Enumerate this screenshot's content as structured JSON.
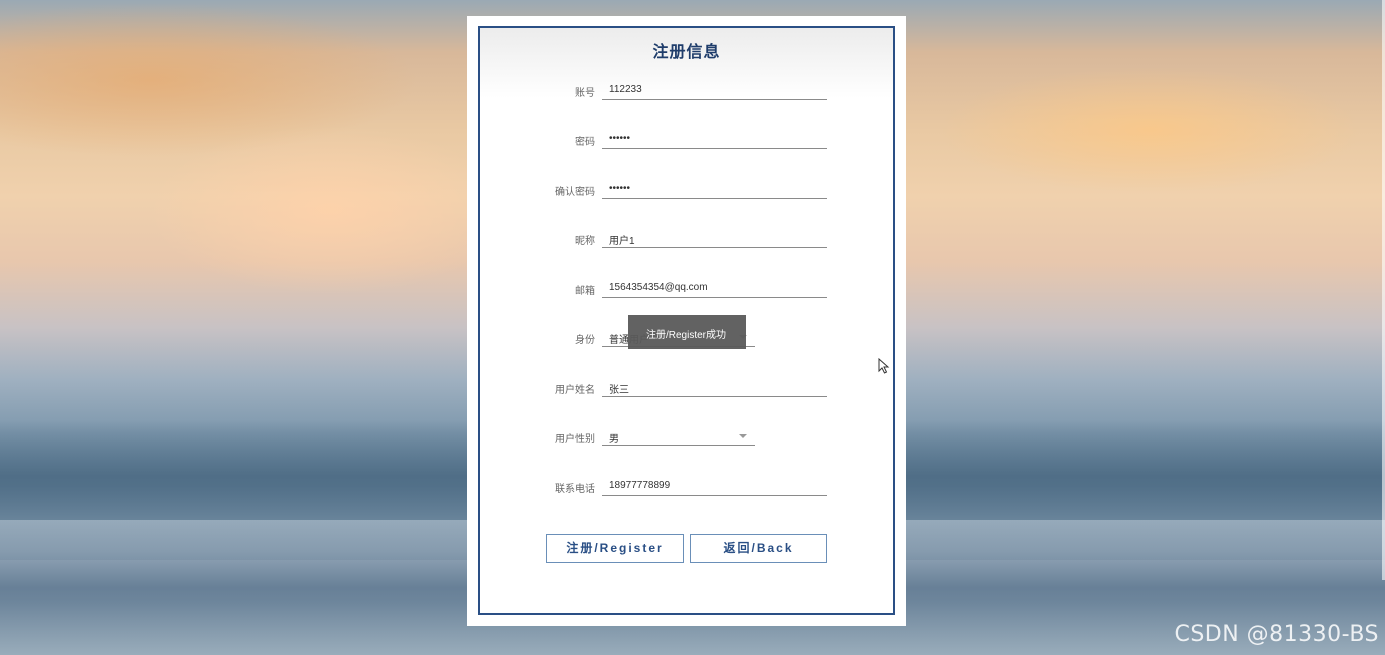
{
  "form": {
    "title": "注册信息",
    "fields": [
      {
        "label": "账号",
        "value": "112233"
      },
      {
        "label": "密码",
        "value": "••••••"
      },
      {
        "label": "确认密码",
        "value": "••••••"
      },
      {
        "label": "昵称",
        "value": "用户1"
      },
      {
        "label": "邮箱",
        "value": "1564354354@qq.com"
      },
      {
        "label": "身份",
        "value": "普通用户"
      },
      {
        "label": "用户姓名",
        "value": "张三"
      },
      {
        "label": "用户性别",
        "value": "男"
      },
      {
        "label": "联系电话",
        "value": "18977778899"
      }
    ],
    "register_button": "注册/Register",
    "back_button": "返回/Back"
  },
  "toast": {
    "message": "注册/Register成功"
  },
  "watermark": "CSDN @81330-BS",
  "colors": {
    "accent": "#2a4f85",
    "button_border": "#6a8fb8",
    "toast_bg": "#5a5a5a"
  }
}
